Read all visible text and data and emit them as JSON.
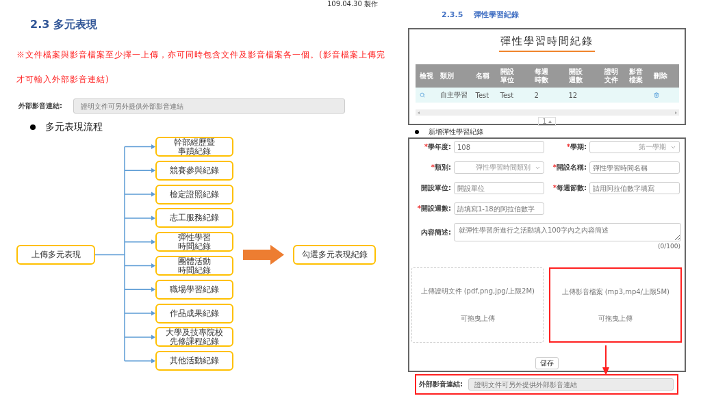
{
  "header_note": "109.04.30 製作",
  "section": {
    "title": "2.3 多元表現",
    "notice": "※文件檔案與影音檔案至少擇一上傳，亦可同時包含文件及影音檔案各一個。(影音檔案上傳完才可輸入外部影音連結)",
    "external_link": {
      "label": "外部影音連結:",
      "placeholder": "證明文件可另外提供外部影音連結",
      "disabled": true
    },
    "bullet": "多元表現流程"
  },
  "flow": {
    "source": "上傳多元表現",
    "targets": [
      "幹部經歷暨事蹟紀錄",
      "競賽參與紀錄",
      "檢定證照紀錄",
      "志工服務紀錄",
      "彈性學習時間紀錄",
      "團體活動時間紀錄",
      "職場學習紀錄",
      "作品成果紀錄",
      "大學及技專院校先修課程紀錄",
      "其他活動紀錄"
    ],
    "result": "勾選多元表現紀錄"
  },
  "subsection": {
    "number": "2.3.5",
    "title": "彈性學習紀錄",
    "record_panel": {
      "title": "彈性學習時間紀錄",
      "columns": [
        "檢視",
        "類別",
        "名稱",
        "開設單位",
        "每週時數",
        "開設週數",
        "證明文件",
        "影音檔案",
        "刪除"
      ],
      "rows": [
        {
          "category": "自主學習",
          "name": "Test",
          "unit": "Test",
          "hours": "2",
          "weeks": "12"
        }
      ],
      "page": "1"
    },
    "form_bullet": "新增彈性學習紀錄",
    "form": {
      "fields": [
        {
          "label": "學年度:",
          "mark": "*",
          "kind": "input",
          "value": "108"
        },
        {
          "label": "學期:",
          "mark": "*",
          "kind": "select",
          "placeholder": "第一學期"
        },
        {
          "label": "類別:",
          "mark": "*",
          "kind": "select",
          "placeholder": "彈性學習時間類別"
        },
        {
          "label": "開設名稱:",
          "mark": "*",
          "kind": "input",
          "placeholder": "彈性學習時間名稱"
        },
        {
          "label": "開設單位:",
          "kind": "input",
          "placeholder": "開設單位"
        },
        {
          "label": "每週節數:",
          "mark": "*",
          "kind": "input",
          "placeholder": "請用阿拉伯數字填寫"
        },
        {
          "label": "開設週數:",
          "mark": "*",
          "kind": "input",
          "placeholder": "請填寫1-18的阿拉伯數字"
        }
      ],
      "description": {
        "label": "內容簡述:",
        "placeholder": "就彈性學習所進行之活動填入100字內之內容簡述",
        "counter": "(0/100)"
      },
      "uploads": [
        {
          "title": "上傳證明文件 (pdf,png,jpg/上限2M)",
          "hint": "可拖曳上傳",
          "highlighted": false
        },
        {
          "title": "上傳影音檔案 (mp3,mp4/上限5M)",
          "hint": "可拖曳上傳",
          "highlighted": true
        }
      ],
      "save": "儲存"
    },
    "external_link": {
      "label": "外部影音連結:",
      "placeholder": "證明文件可另外提供外部影音連結",
      "disabled": true,
      "highlighted": true
    }
  }
}
